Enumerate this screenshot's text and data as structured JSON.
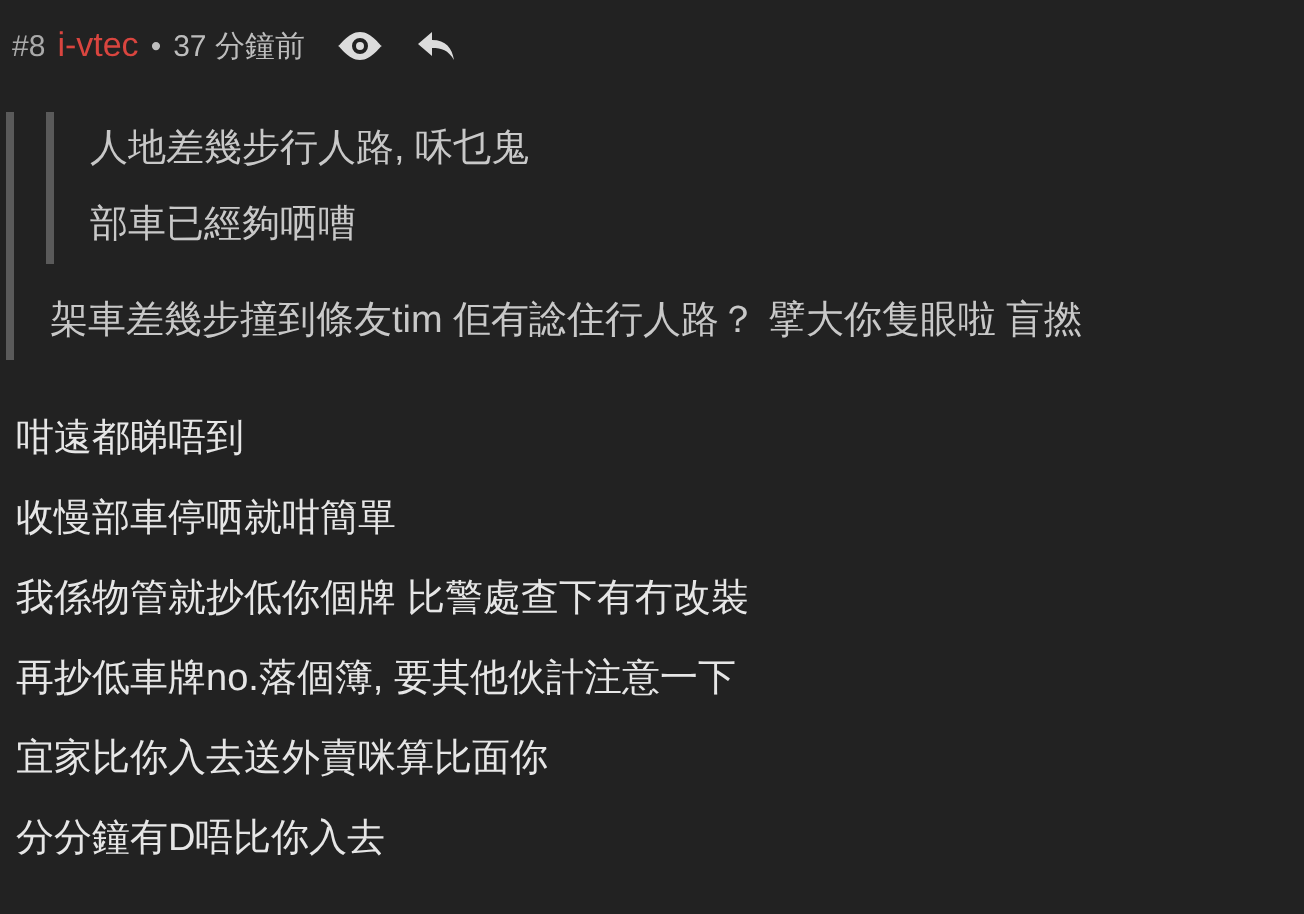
{
  "post": {
    "number": "#8",
    "author": "i-vtec",
    "separator": "•",
    "time": "37 分鐘前"
  },
  "quote": {
    "quote": {
      "lines": [
        "人地差幾步行人路, 咊乜鬼",
        "部車已經夠哂嘈"
      ]
    },
    "lines": [
      "架車差幾步撞到條友tim 佢有諗住行人路？ 擘大你隻眼啦 盲撚"
    ]
  },
  "body": [
    "咁遠都睇唔到",
    "收慢部車停哂就咁簡單",
    "我係物管就抄低你個牌 比警處查下有冇改裝",
    "再抄低車牌no.落個簿, 要其他伙計注意一下",
    "宜家比你入去送外賣咪算比面你",
    "分分鐘有D唔比你入去"
  ]
}
